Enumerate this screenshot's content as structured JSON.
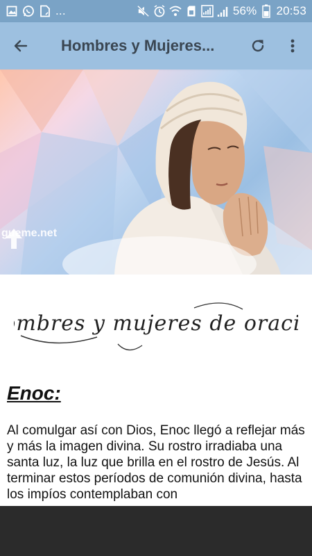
{
  "status_bar": {
    "notification_dots": "...",
    "battery_percent": "56%",
    "time": "20:53"
  },
  "app_bar": {
    "title": "Hombres y Mujeres..."
  },
  "hero": {
    "watermark": "gueme.net"
  },
  "content": {
    "banner_script": "Hombres y mujeres de oracion",
    "heading": "Enoc:",
    "paragraph": "Al comulgar así con Dios, Enoc llegó a reflejar más y más la imagen divina. Su rostro irradiaba una santa luz, la luz que brilla en el rostro de Jesús. Al terminar estos períodos de comunión divina, hasta los impíos contemplaban con"
  },
  "colors": {
    "status_bar": "#7aa3c6",
    "app_bar": "#9dc0e0",
    "nav_bar": "#2b2b2b"
  }
}
